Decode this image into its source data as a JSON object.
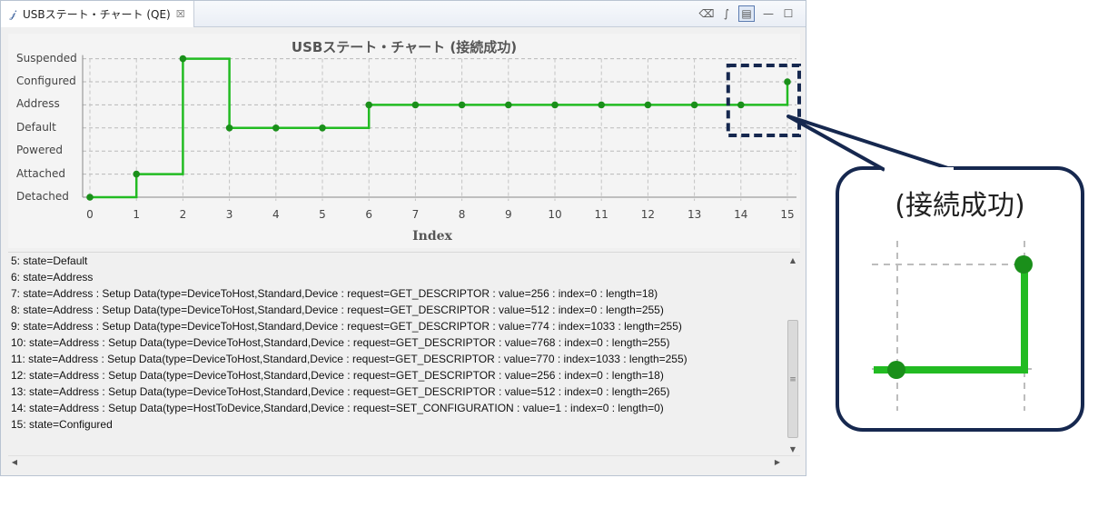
{
  "tab": {
    "title": "USBステート・チャート (QE)",
    "icon": "probe-icon",
    "close_symbol": "☒"
  },
  "toolbar": {
    "buttons": [
      {
        "name": "clear-icon",
        "glyph": "⌫"
      },
      {
        "name": "waveform-icon",
        "glyph": "∫"
      },
      {
        "name": "layout-toggle-icon",
        "glyph": "▤"
      },
      {
        "name": "minimize-icon",
        "glyph": "—"
      },
      {
        "name": "maximize-icon",
        "glyph": "☐"
      }
    ]
  },
  "chart_data": {
    "type": "line",
    "step": true,
    "title": "USBステート・チャート (接続成功)",
    "xlabel": "Index",
    "ylabel": "",
    "y_categories": [
      "Detached",
      "Attached",
      "Powered",
      "Default",
      "Address",
      "Configured",
      "Suspended"
    ],
    "x": [
      0,
      1,
      2,
      3,
      4,
      5,
      6,
      7,
      8,
      9,
      10,
      11,
      12,
      13,
      14,
      15
    ],
    "states": [
      "Detached",
      "Attached",
      "Suspended",
      "Default",
      "Default",
      "Default",
      "Address",
      "Address",
      "Address",
      "Address",
      "Address",
      "Address",
      "Address",
      "Address",
      "Address",
      "Configured"
    ],
    "xlim": [
      0,
      15
    ],
    "grid": true,
    "line_color": "#22bb22",
    "marker_color": "#1a8f1a",
    "highlight": {
      "x_range": [
        14,
        15
      ],
      "border_color": "#16284f"
    }
  },
  "console": {
    "lines": [
      "5: state=Default",
      "6: state=Address",
      "7: state=Address : Setup Data(type=DeviceToHost,Standard,Device : request=GET_DESCRIPTOR : value=256 : index=0 : length=18)",
      "8: state=Address : Setup Data(type=DeviceToHost,Standard,Device : request=GET_DESCRIPTOR : value=512 : index=0 : length=255)",
      "9: state=Address : Setup Data(type=DeviceToHost,Standard,Device : request=GET_DESCRIPTOR : value=774 : index=1033 : length=255)",
      "10: state=Address : Setup Data(type=DeviceToHost,Standard,Device : request=GET_DESCRIPTOR : value=768 : index=0 : length=255)",
      "11: state=Address : Setup Data(type=DeviceToHost,Standard,Device : request=GET_DESCRIPTOR : value=770 : index=1033 : length=255)",
      "12: state=Address : Setup Data(type=DeviceToHost,Standard,Device : request=GET_DESCRIPTOR : value=256 : index=0 : length=18)",
      "13: state=Address : Setup Data(type=DeviceToHost,Standard,Device : request=GET_DESCRIPTOR : value=512 : index=0 : length=265)",
      "14: state=Address : Setup Data(type=HostToDevice,Standard,Device : request=SET_CONFIGURATION : value=1 : index=0 : length=0)",
      "15: state=Configured"
    ]
  },
  "callout": {
    "text": "(接続成功)",
    "border_color": "#16284f"
  }
}
